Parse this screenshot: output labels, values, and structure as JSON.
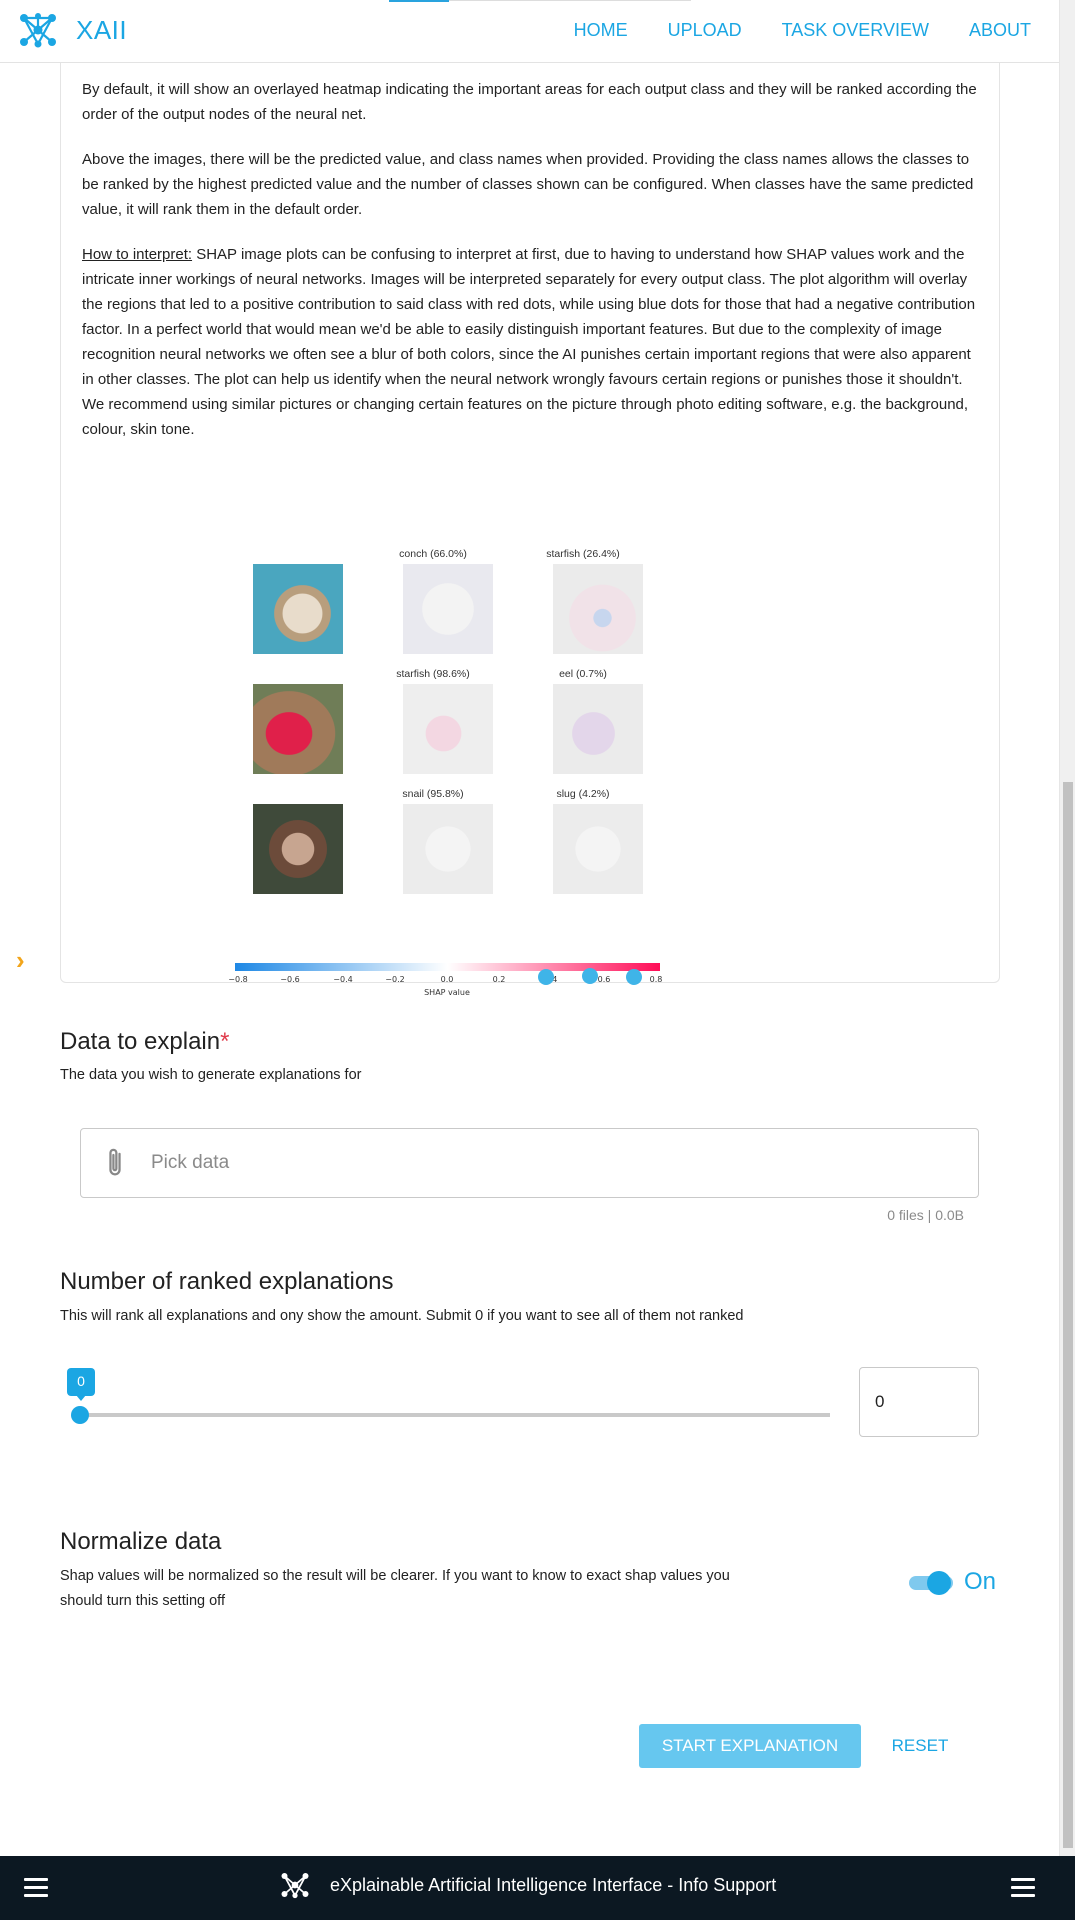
{
  "header": {
    "logo_text": "XAII",
    "nav": [
      "HOME",
      "UPLOAD",
      "TASK OVERVIEW",
      "ABOUT"
    ]
  },
  "info": {
    "p1": "By default, it will show an overlayed heatmap indicating the important areas for each output class and they will be ranked according the order of the output nodes of the neural net.",
    "p2": "Above the images, there will be the predicted value, and class names when provided. Providing the class names allows the classes to be ranked by the highest predicted value and the number of classes shown can be configured. When classes have the same predicted value, it will rank them in the default order.",
    "p3_label": "How to interpret:",
    "p3": " SHAP image plots can be confusing to interpret at first, due to having to understand how SHAP values work and the intricate inner workings of neural networks. Images will be interpreted separately for every output class. The plot algorithm will overlay the regions that led to a positive contribution to said class with red dots, while using blue dots for those that had a negative contribution factor. In a perfect world that would mean we'd be able to easily distinguish important features. But due to the complexity of image recognition neural networks we often see a blur of both colors, since the AI punishes certain important regions that were also apparent in other classes. The plot can help us identify when the neural network wrongly favours certain regions or punishes those it shouldn't. We recommend using similar pictures or changing certain features on the picture through photo editing software, e.g. the background, colour, skin tone."
  },
  "shap_plot": {
    "rows": [
      {
        "c1": "conch (66.0%)",
        "c2": "starfish (26.4%)"
      },
      {
        "c1": "starfish (98.6%)",
        "c2": "eel (0.7%)"
      },
      {
        "c1": "snail (95.8%)",
        "c2": "slug (4.2%)"
      }
    ],
    "colorbar_ticks": [
      "−0.8",
      "−0.6",
      "−0.4",
      "−0.2",
      "0.0",
      "0.2",
      "0.4",
      "0.6",
      "0.8"
    ],
    "colorbar_label": "SHAP value",
    "colors": {
      "negative": "#1e88e5",
      "positive": "#ff0d57"
    }
  },
  "data_section": {
    "title": "Data to explain",
    "required_mark": "*",
    "description": "The data you wish to generate explanations for",
    "placeholder": "Pick data",
    "hint": "0 files | 0.0B"
  },
  "ranked_section": {
    "title": "Number of ranked explanations",
    "description": "This will rank all explanations and ony show the amount. Submit 0 if you want to see all of them not ranked",
    "slider_value": "0",
    "input_value": "0"
  },
  "normalize_section": {
    "title": "Normalize data",
    "description": "Shap values will be normalized so the result will be clearer. If you want to know to exact shap values you should turn this setting off",
    "toggle_label": "On",
    "toggle_on": true
  },
  "actions": {
    "start": "START EXPLANATION",
    "reset": "RESET"
  },
  "footer": {
    "text": "eXplainable Artificial Intelligence Interface - Info Support"
  },
  "theme": {
    "accent": "#1ba6e3",
    "footer_bg": "#0c1822",
    "arrow": "#f2a51b"
  }
}
